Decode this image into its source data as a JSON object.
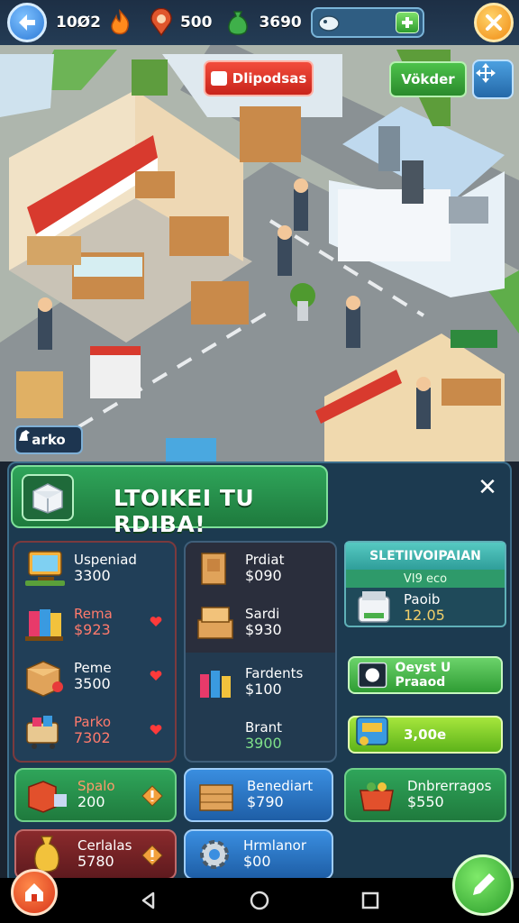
{
  "hud": {
    "coins": "10Ø2",
    "gems": "500",
    "cash": "3690"
  },
  "world": {
    "dispense_label": "Dlipodsas",
    "worker_label": "Vökder",
    "area_label": "arko"
  },
  "panel": {
    "title": "LTOIKEI TU RDIBA!",
    "close_symbol": "✕",
    "column1": [
      {
        "name": "Uspeniad",
        "price": "3300",
        "icon": "computer-icon",
        "tone": "white",
        "heart": false
      },
      {
        "name": "Rema",
        "price": "$923",
        "icon": "gift-box-icon",
        "tone": "red",
        "heart": true
      },
      {
        "name": "Peme",
        "price": "3500",
        "icon": "box-icon",
        "tone": "white",
        "heart": true
      },
      {
        "name": "Parko",
        "price": "7302",
        "icon": "cart-icon",
        "tone": "red",
        "heart": true
      }
    ],
    "column2": [
      {
        "name": "Prdiat",
        "price": "$090",
        "icon": "crate-icon",
        "tone": "white"
      },
      {
        "name": "Sardi",
        "price": "$930",
        "icon": "crate-stack-icon",
        "tone": "white"
      },
      {
        "name": "Fardents",
        "price": "$100",
        "icon": "bottles-icon",
        "tone": "white"
      },
      {
        "name": "Brant",
        "price": "3900",
        "icon": "blank",
        "tone": "green"
      }
    ],
    "sale": {
      "title": "SLETIIVOIPAIAN",
      "subtitle": "VI9 eco",
      "product_name": "Paoib",
      "product_price": "12.05",
      "button1_label": "Oeyst U Praaod",
      "button2_label": "3,00e"
    },
    "row_bottom": [
      {
        "name": "Spalo",
        "price": "200",
        "icon": "cube-icon"
      },
      {
        "name": "Benediart",
        "price": "$790",
        "icon": "crate-icon"
      },
      {
        "name": "Dnbrerragos",
        "price": "$550",
        "icon": "basket-icon"
      }
    ],
    "row_last": [
      {
        "name": "Cerlalas",
        "price": "5780",
        "icon": "money-bag-icon"
      },
      {
        "name": "Hrmlanor",
        "price": "$00",
        "icon": "gear-icon"
      }
    ]
  },
  "colors": {
    "panel_bg": "#1c3a50",
    "header_green": "#2fa55a",
    "accent_red": "#ff7a6c",
    "accent_green": "#7fe08a"
  }
}
